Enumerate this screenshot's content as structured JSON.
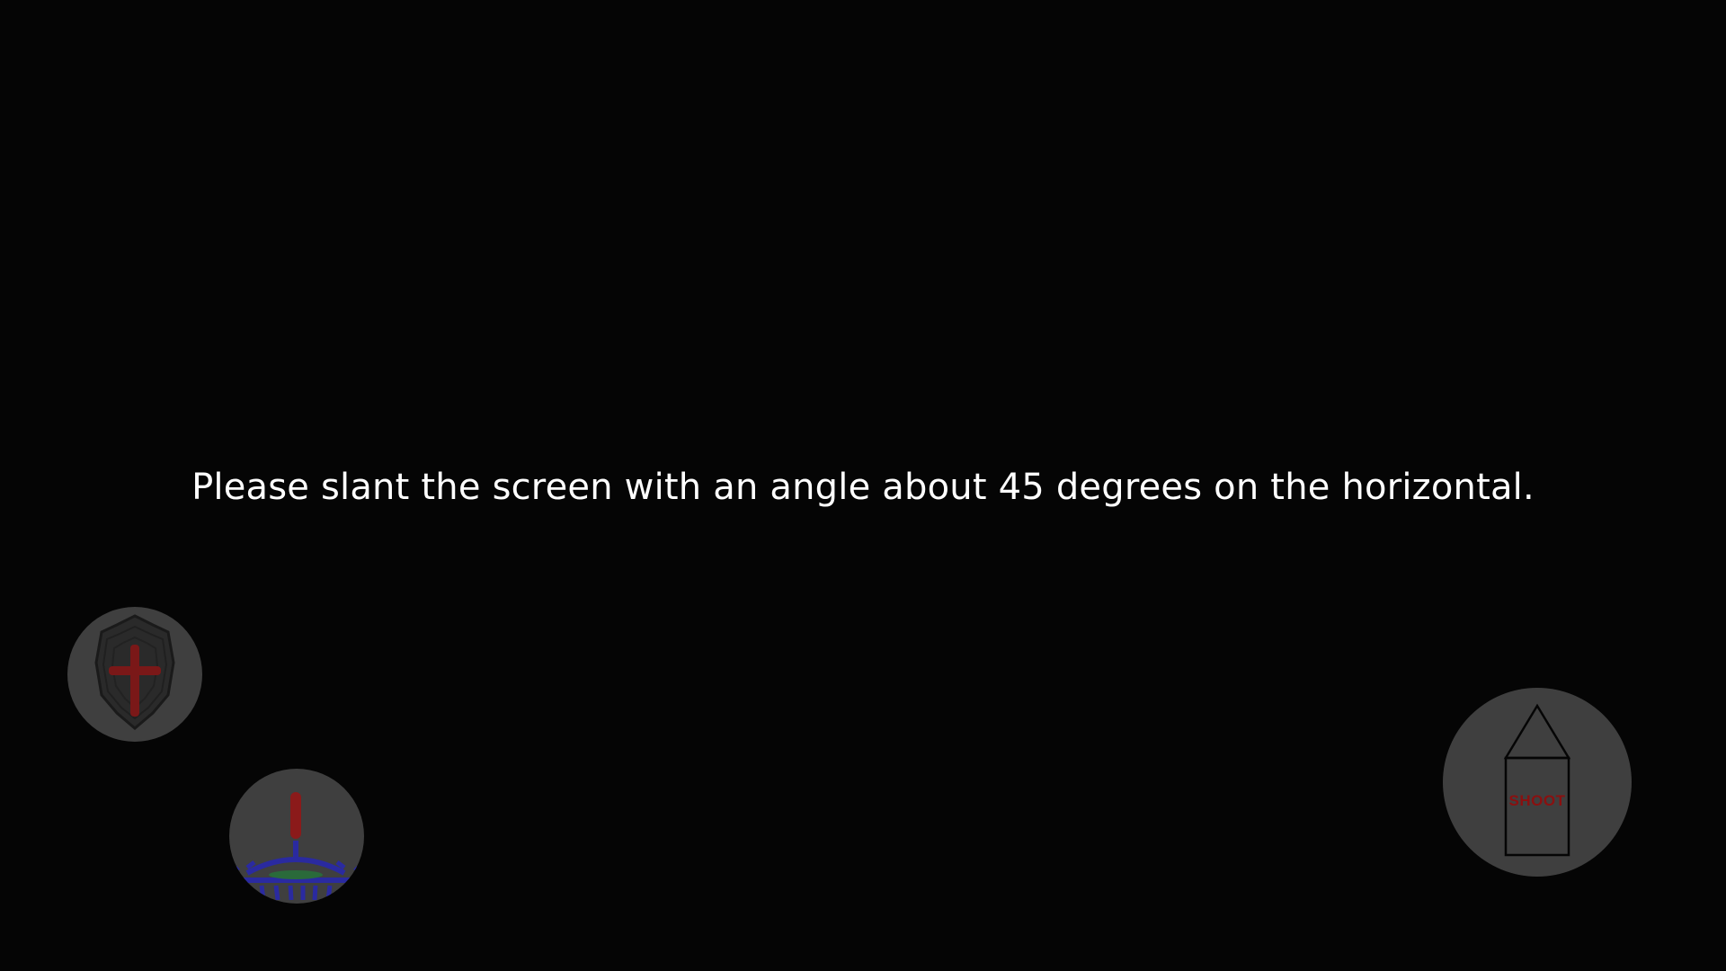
{
  "instruction": {
    "text": "Please slant the screen with an angle about 45 degrees on the horizontal."
  },
  "controls": {
    "shield": {
      "icon": "shield-icon"
    },
    "bomb": {
      "icon": "bomb-icon"
    },
    "shoot": {
      "label": "SHOOT",
      "icon": "rocket-icon"
    }
  },
  "colors": {
    "background": "#050505",
    "button_fill": "#3f3f3f",
    "text": "#ffffff",
    "shoot_label": "#8a1010",
    "shield_cross": "#8b1a1a",
    "bomb_body": "#2a2aa0"
  }
}
